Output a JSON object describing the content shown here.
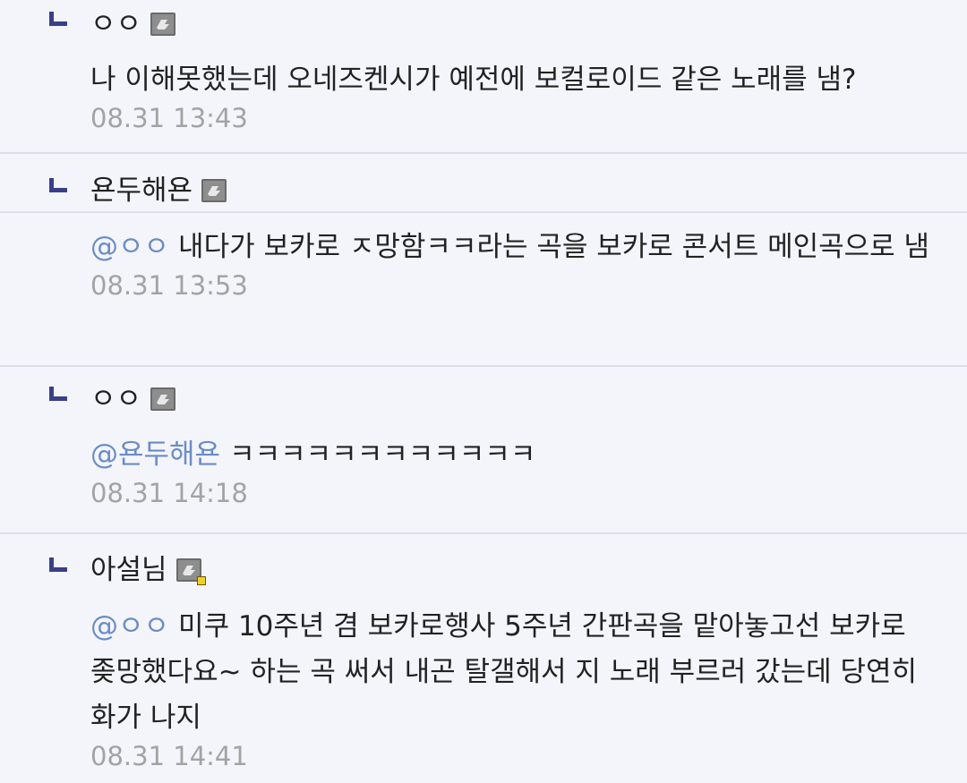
{
  "comments": [
    {
      "nickname": "ㅇㅇ",
      "mention": "",
      "text": "나 이해못했는데 오네즈켄시가 예전에 보컬로이드 같은 노래를 냄?",
      "date": "08.31 13:43",
      "icon": "fixed-member-icon"
    },
    {
      "nickname": "욘두해욘",
      "mention": "@ㅇㅇ",
      "text": "내다가 보카로 ㅈ망함ㅋㅋ라는 곡을 보카로 콘서트 메인곡으로 냄",
      "date": "08.31 13:53",
      "icon": "fixed-member-icon"
    },
    {
      "nickname": "ㅇㅇ",
      "mention": "@욘두해욘",
      "text": "ㅋㅋㅋㅋㅋㅋㅋㅋㅋㅋㅋㅋ",
      "date": "08.31 14:18",
      "icon": "fixed-member-icon"
    },
    {
      "nickname": "아설님",
      "mention": "@ㅇㅇ",
      "text": "미쿠 10주년 겸 보카로행사 5주년 간판곡을 맡아놓고선 보카로 좆망했다요~ 하는 곡 써서 내곤 탈갤해서 지 노래 부르러 갔는데 당연히 화가 나지",
      "date": "08.31 14:41",
      "icon": "semi-fixed-member-icon"
    }
  ],
  "colors": {
    "background": "#f4f5fb",
    "mention": "#6a8cc6",
    "date": "#a3a3a3",
    "reply_mark": "#3a3f8a",
    "divider": "#dcdfea"
  }
}
